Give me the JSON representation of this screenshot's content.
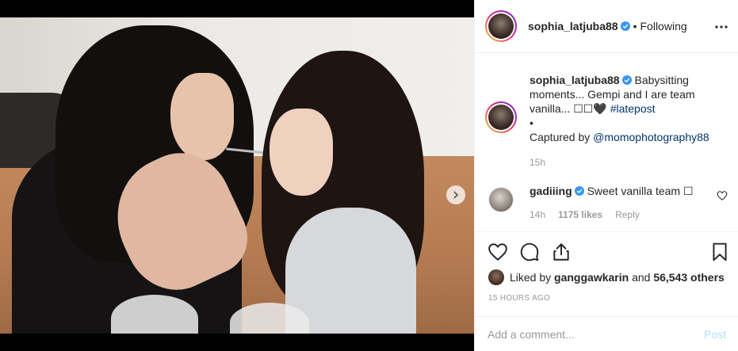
{
  "header": {
    "username": "sophia_latjuba88",
    "bullet": "•",
    "follow_status": "Following"
  },
  "caption": {
    "username": "sophia_latjuba88",
    "text_1": "Babysitting moments... Gempi and I are team vanilla... ",
    "emoji": "☐☐🖤",
    "hashtag": "#latepost",
    "bullet": "•",
    "captured_prefix": "Captured by ",
    "mention": "@momophotography88",
    "time": "15h"
  },
  "comment": {
    "username": "gadiiing",
    "text": "Sweet vanilla team ☐",
    "time": "14h",
    "likes": "1175 likes",
    "reply": "Reply"
  },
  "likes": {
    "prefix": "Liked by ",
    "user": "ganggawkarin",
    "middle": " and ",
    "count": "56,543 others"
  },
  "post_time": "15 HOURS AGO",
  "comment_box": {
    "placeholder": "Add a comment...",
    "post_label": "Post"
  },
  "colors": {
    "verified": "#3897f0",
    "link": "#003569",
    "muted": "#999999",
    "post_disabled": "#b2dffc"
  },
  "icons": [
    "heart-icon",
    "comment-icon",
    "share-icon",
    "bookmark-icon",
    "more-options-icon",
    "chevron-right-icon",
    "verified-badge-icon"
  ],
  "carousel": {
    "total": 2,
    "active": 1
  }
}
